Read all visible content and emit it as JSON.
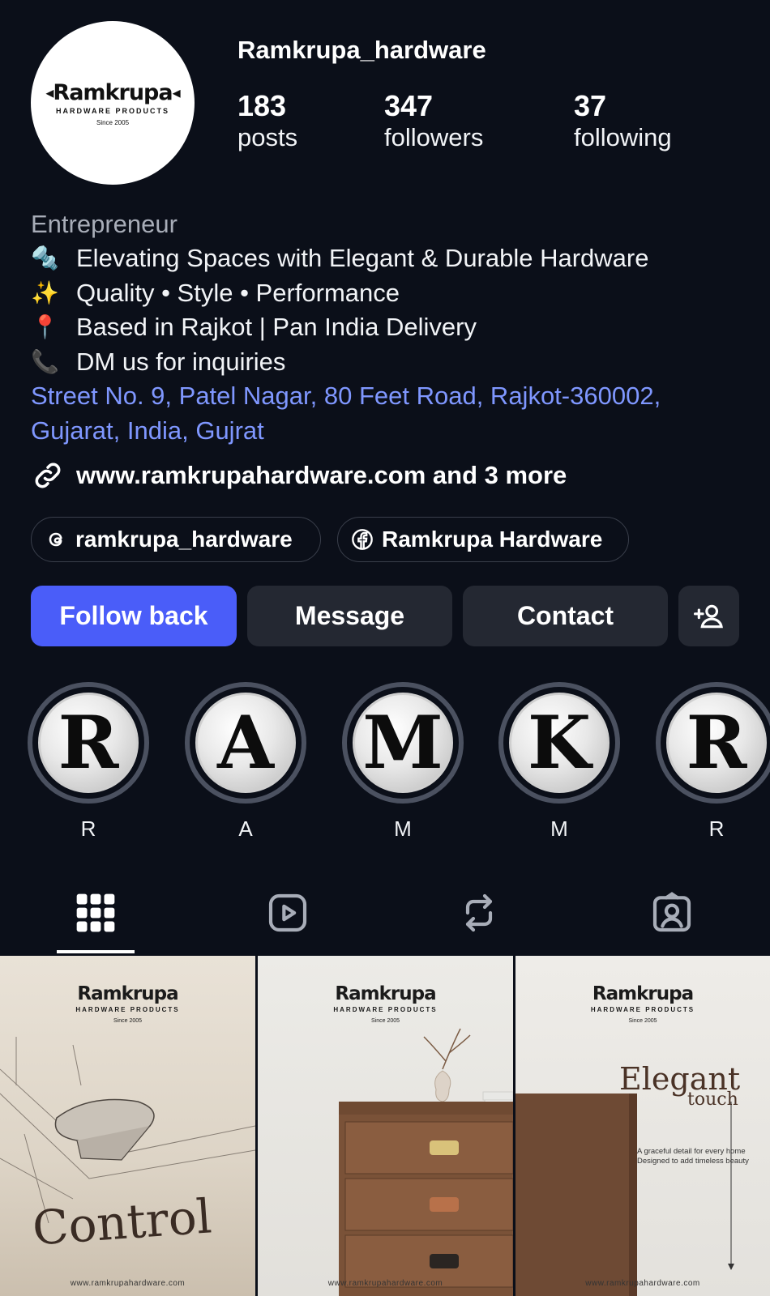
{
  "profile": {
    "logo": {
      "word": "Ramkrupa",
      "subtitle": "HARDWARE PRODUCTS",
      "since": "Since 2005"
    },
    "username": "Ramkrupa_hardware",
    "stats": [
      {
        "value": "183",
        "label": "posts"
      },
      {
        "value": "347",
        "label": "followers"
      },
      {
        "value": "37",
        "label": "following"
      }
    ]
  },
  "bio": {
    "category": "Entrepreneur",
    "lines": [
      {
        "emoji": "🔩",
        "text": "Elevating Spaces with Elegant & Durable Hardware"
      },
      {
        "emoji": "✨",
        "text": "Quality • Style • Performance"
      },
      {
        "emoji": "📍",
        "text": "Based in Rajkot | Pan India Delivery"
      },
      {
        "emoji": "📞",
        "text": "DM us for inquiries"
      }
    ],
    "address_line1": "Street No. 9, Patel Nagar, 80 Feet Road, Rajkot-360002,",
    "address_line2": "Gujarat, India, Gujrat",
    "link_text": "www.ramkrupahardware.com and 3 more"
  },
  "chips": {
    "threads": "ramkrupa_hardware",
    "facebook": "Ramkrupa Hardware"
  },
  "actions": {
    "follow_back": "Follow back",
    "message": "Message",
    "contact": "Contact"
  },
  "highlights": [
    {
      "letter": "R",
      "caption": "R"
    },
    {
      "letter": "A",
      "caption": "A"
    },
    {
      "letter": "M",
      "caption": "M"
    },
    {
      "letter": "K",
      "caption": "M"
    },
    {
      "letter": "R",
      "caption": "R"
    }
  ],
  "tabs": [
    "grid-icon",
    "reels-icon",
    "reposts-icon",
    "tagged-icon"
  ],
  "posts": [
    {
      "title": "Control",
      "url": "www.ramkrupahardware.com"
    },
    {
      "title": "",
      "url": "www.ramkrupahardware.com"
    },
    {
      "title": "Elegant",
      "title2": "touch",
      "caption1": "A graceful detail for every home",
      "caption2": "Designed to add timeless beauty",
      "url": "www.ramkrupahardware.com"
    }
  ],
  "colors": {
    "background": "#0b0f19",
    "primary_button": "#4a5df9",
    "secondary_button": "#242832",
    "address_link": "#7f97ff"
  }
}
